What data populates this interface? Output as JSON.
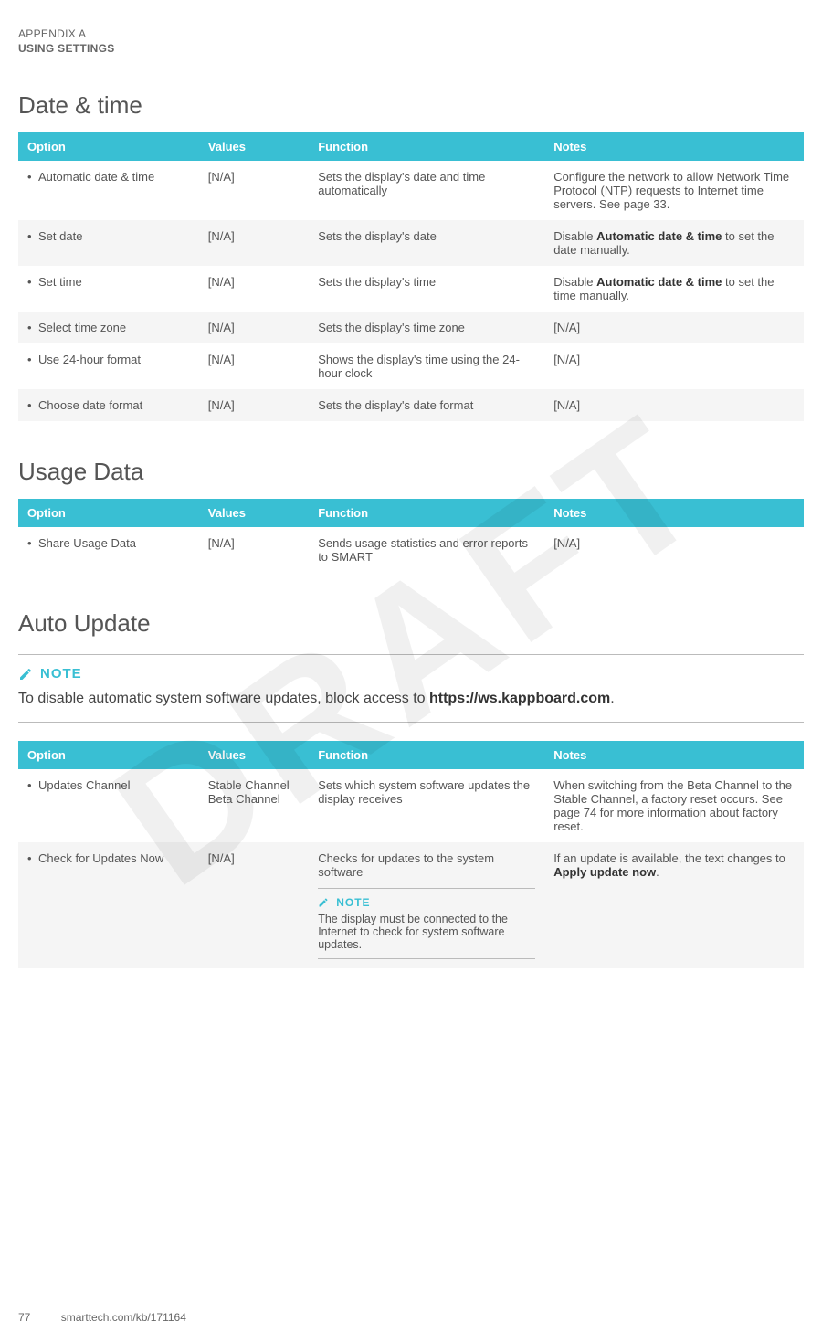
{
  "header": {
    "appendix": "APPENDIX A",
    "title": "USING SETTINGS"
  },
  "columns": {
    "option": "Option",
    "values": "Values",
    "function": "Function",
    "notes": "Notes"
  },
  "sections": {
    "dateTime": {
      "title": "Date & time",
      "rows": [
        {
          "option": "Automatic date & time",
          "values": "[N/A]",
          "function": "Sets the display's date and time automatically",
          "notes": "Configure the network to allow Network Time Protocol (NTP) requests to Internet time servers. See page 33."
        },
        {
          "option": "Set date",
          "values": "[N/A]",
          "function": "Sets the display's date",
          "notes_pre": "Disable ",
          "notes_bold": "Automatic date & time",
          "notes_post": " to set the date manually."
        },
        {
          "option": "Set time",
          "values": "[N/A]",
          "function": "Sets the display's time",
          "notes_pre": "Disable ",
          "notes_bold": "Automatic date & time",
          "notes_post": " to set the time manually."
        },
        {
          "option": "Select time zone",
          "values": "[N/A]",
          "function": "Sets the display's time zone",
          "notes": "[N/A]"
        },
        {
          "option": "Use 24-hour format",
          "values": "[N/A]",
          "function": "Shows the display's time using the 24-hour clock",
          "notes": "[N/A]"
        },
        {
          "option": "Choose date format",
          "values": "[N/A]",
          "function": "Sets the display's date format",
          "notes": "[N/A]"
        }
      ]
    },
    "usageData": {
      "title": "Usage Data",
      "rows": [
        {
          "option": "Share Usage Data",
          "values": "[N/A]",
          "function": "Sends usage statistics and error reports to SMART",
          "notes": "[N/A]"
        }
      ]
    },
    "autoUpdate": {
      "title": "Auto Update",
      "noteLabel": "NOTE",
      "noteText_pre": "To disable automatic system software updates, block access to ",
      "noteText_bold": "https://ws.kappboard.com",
      "noteText_post": ".",
      "rows": [
        {
          "option": "Updates Channel",
          "values_l1": "Stable Channel",
          "values_l2": "Beta Channel",
          "function": "Sets which system software updates the display receives",
          "notes": "When switching from the Beta Channel to the Stable Channel, a factory reset occurs. See page 74 for more information about factory reset."
        },
        {
          "option": "Check for Updates Now",
          "values": "[N/A]",
          "function": "Checks for updates to the system software",
          "inline_note_label": "NOTE",
          "inline_note_body": "The display must be connected to the Internet to check for system software updates.",
          "notes_pre": "If an update is available, the text changes to ",
          "notes_bold": "Apply update now",
          "notes_post": "."
        }
      ]
    }
  },
  "footer": {
    "page": "77",
    "url": "smarttech.com/kb/171164"
  }
}
